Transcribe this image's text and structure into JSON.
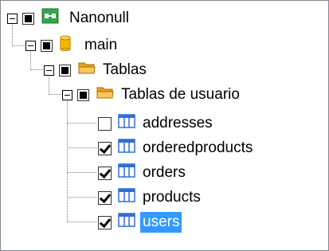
{
  "tree": {
    "root": {
      "label": "Nanonull",
      "icon": "database-connection-icon"
    },
    "schema": {
      "label": "main",
      "icon": "database-cylinder-icon"
    },
    "folder": {
      "label": "Tablas",
      "icon": "folder-icon"
    },
    "subfolder": {
      "label": "Tablas de usuario",
      "icon": "folder-icon"
    },
    "tables": [
      {
        "label": "addresses",
        "checked": false,
        "icon": "table-icon"
      },
      {
        "label": "orderedproducts",
        "checked": true,
        "icon": "table-icon"
      },
      {
        "label": "orders",
        "checked": true,
        "icon": "table-icon"
      },
      {
        "label": "products",
        "checked": true,
        "icon": "table-icon"
      },
      {
        "label": "users",
        "checked": true,
        "icon": "table-icon",
        "selected": true
      }
    ]
  },
  "colors": {
    "selection": "#3399ff",
    "folder": "#f5b642",
    "db_icon": "#f5b800",
    "table_icon": "#2f6fd6",
    "root_icon": "#33a64a"
  }
}
